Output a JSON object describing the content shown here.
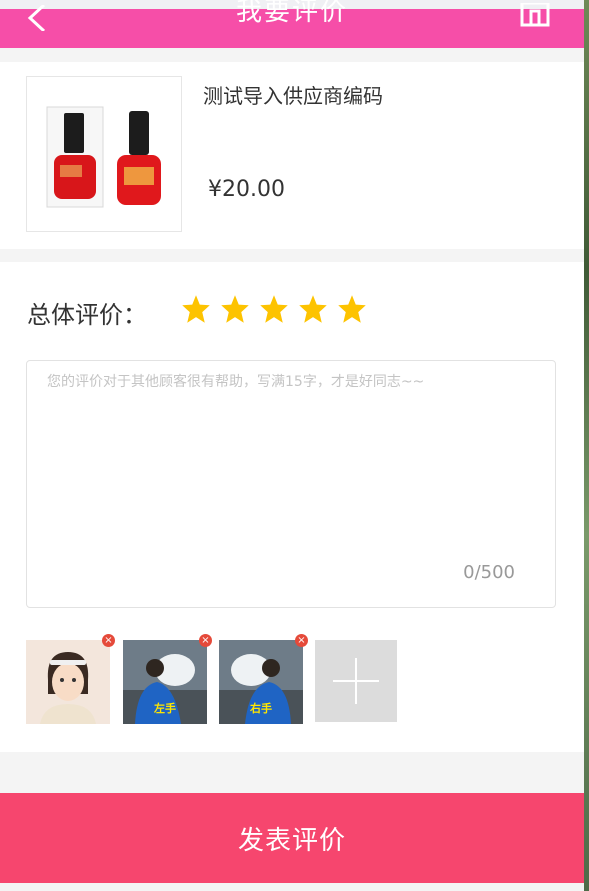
{
  "header": {
    "title": "我要评价",
    "back_icon": "chevron-left-icon",
    "right_icon": "home-icon"
  },
  "product": {
    "name": "测试导入供应商编码",
    "price": "¥20.00"
  },
  "rating": {
    "label": "总体评价：",
    "stars": 5,
    "star_color": "#fdc300"
  },
  "comment": {
    "placeholder": "您的评价对于其他顾客很有帮助，写满15字，才是好同志~~",
    "value": "",
    "count": "0/500"
  },
  "photos": [
    {
      "label": ""
    },
    {
      "label": "左手"
    },
    {
      "label": "右手"
    }
  ],
  "submit": {
    "label": "发表评价"
  },
  "colors": {
    "header_bg": "#f64ea8",
    "submit_bg": "#f6466e",
    "remove_badge": "#e54a3a"
  }
}
